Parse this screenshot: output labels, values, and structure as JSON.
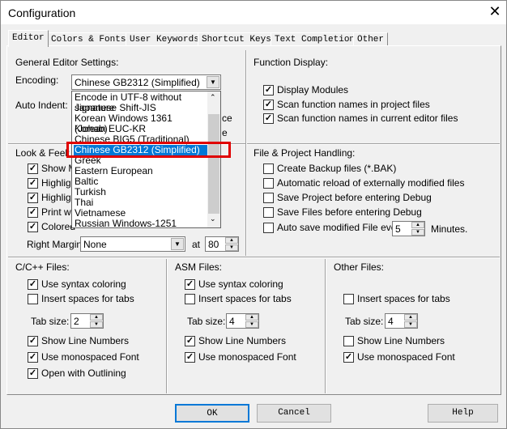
{
  "window": {
    "title": "Configuration",
    "close_icon": "close-icon"
  },
  "tabs": [
    "Editor",
    "Colors & Fonts",
    "User Keywords",
    "Shortcut Keys",
    "Text Completion",
    "Other"
  ],
  "general": {
    "heading": "General Editor Settings:",
    "encoding_label": "Encoding:",
    "encoding_value": "Chinese GB2312 (Simplified)",
    "auto_indent_label": "Auto Indent:",
    "hidden_fragments": [
      "ce",
      "e"
    ]
  },
  "encoding_options": [
    "Encode in UTF-8 without signature",
    "Japanese Shift-JIS",
    "Korean Windows 1361 (Johab)",
    "Korean EUC-KR",
    "Chinese BIG5 (Traditional)",
    "Chinese GB2312 (Simplified)",
    "Greek",
    "Eastern European",
    "Baltic",
    "Turkish",
    "Thai",
    "Vietnamese",
    "Russian Windows-1251"
  ],
  "encoding_selected_index": 5,
  "look": {
    "heading": "Look & Feel:",
    "items": [
      {
        "label": "Show M",
        "checked": true
      },
      {
        "label": "Highligh",
        "checked": true
      },
      {
        "label": "Highligh",
        "checked": true
      },
      {
        "label": "Print wit",
        "checked": true
      },
      {
        "label": "Colored",
        "checked": true
      }
    ],
    "right_margin_label": "Right Margin:",
    "right_margin_value": "None",
    "at_label": "at",
    "at_value": "80"
  },
  "function": {
    "heading": "Function Display:",
    "items": [
      {
        "label": "Display Modules",
        "checked": true
      },
      {
        "label": "Scan function names in project files",
        "checked": true
      },
      {
        "label": "Scan function names in current editor files",
        "checked": true
      }
    ]
  },
  "file": {
    "heading": "File & Project Handling:",
    "items": [
      {
        "label": "Create Backup files (*.BAK)",
        "checked": false
      },
      {
        "label": "Automatic reload of externally modified files",
        "checked": false
      },
      {
        "label": "Save Project before entering Debug",
        "checked": false
      },
      {
        "label": "Save Files before entering Debug",
        "checked": false
      },
      {
        "label": "Auto save modified File every",
        "checked": false
      }
    ],
    "autosave_value": "5",
    "minutes_label": "Minutes."
  },
  "cfiles": {
    "heading": "C/C++ Files:",
    "tab_size_label": "Tab size:",
    "tab_size": "2",
    "items": [
      {
        "label": "Use syntax coloring",
        "checked": true
      },
      {
        "label": "Insert spaces for tabs",
        "checked": false
      },
      {
        "label": "Show Line Numbers",
        "checked": true
      },
      {
        "label": "Use monospaced Font",
        "checked": true
      },
      {
        "label": "Open with Outlining",
        "checked": true
      }
    ]
  },
  "asm": {
    "heading": "ASM Files:",
    "tab_size_label": "Tab size:",
    "tab_size": "4",
    "items": [
      {
        "label": "Use syntax coloring",
        "checked": true
      },
      {
        "label": "Insert spaces for tabs",
        "checked": false
      },
      {
        "label": "Show Line Numbers",
        "checked": true
      },
      {
        "label": "Use monospaced Font",
        "checked": true
      }
    ]
  },
  "other": {
    "heading": "Other Files:",
    "tab_size_label": "Tab size:",
    "tab_size": "4",
    "items": [
      {
        "label": "Insert spaces for tabs",
        "checked": false
      },
      {
        "label": "Show Line Numbers",
        "checked": false
      },
      {
        "label": "Use monospaced Font",
        "checked": true
      }
    ]
  },
  "buttons": {
    "ok": "OK",
    "cancel": "Cancel",
    "help": "Help"
  },
  "colors": {
    "selection": "#0078d7",
    "highlight_box": "#e00000"
  }
}
